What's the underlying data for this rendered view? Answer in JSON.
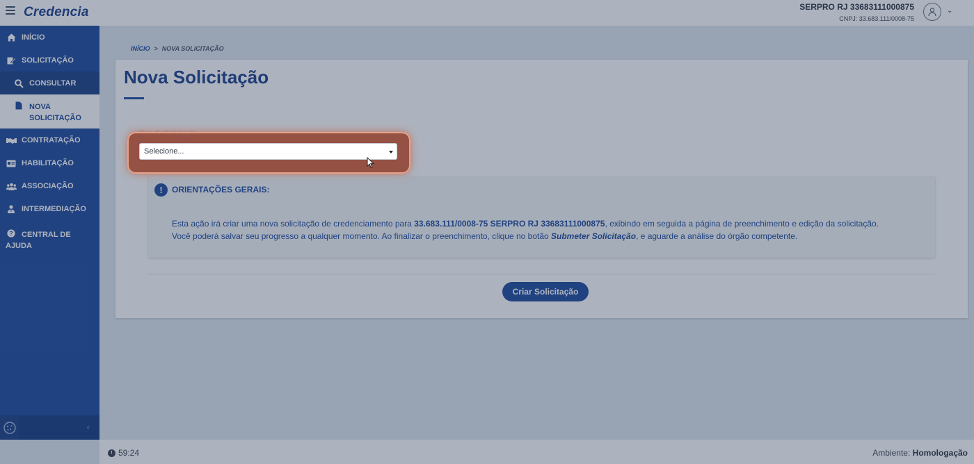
{
  "app": {
    "brand": "Credencia"
  },
  "header": {
    "org_name": "SERPRO RJ 33683111000875",
    "org_cnpj": "CNPJ: 33.683.111/0008-75"
  },
  "sidebar": {
    "items": [
      {
        "label": "Início",
        "icon": "home-icon"
      },
      {
        "label": "Solicitação",
        "icon": "edit-icon"
      },
      {
        "label": "Consultar",
        "icon": "search-icon"
      },
      {
        "label": "Nova Solicitação",
        "icon": "file-icon"
      },
      {
        "label": "Contratação",
        "icon": "handshake-icon"
      },
      {
        "label": "Habilitação",
        "icon": "id-card-icon"
      },
      {
        "label": "Associação",
        "icon": "users-icon"
      },
      {
        "label": "Intermediação",
        "icon": "user-tie-icon"
      },
      {
        "label": "Central de Ajuda",
        "icon": "help-icon"
      }
    ]
  },
  "breadcrumb": {
    "home": "INÍCIO",
    "sep": ">",
    "current": "NOVA SOLICITAÇÃO"
  },
  "main": {
    "title": "Nova Solicitação",
    "field_label": "Tipo de Solicitação",
    "select_value": "Selecione...",
    "orient_title": "ORIENTAÇÕES GERAIS:",
    "line1_pre": "Esta ação irá criar uma nova solicitação de credenciamento para ",
    "line1_bold": "33.683.111/0008-75 SERPRO RJ 33683111000875",
    "line1_post": ", exibindo em seguida a página de preenchimento e edição da solicitação.",
    "line2_pre": "Você poderá salvar seu progresso a qualquer momento. Ao finalizar o preenchimento, clique no botão ",
    "line2_em": "Submeter Solicitação",
    "line2_post": ", e aguarde a análise do órgão competente.",
    "create_button": "Criar Solicitação"
  },
  "footer": {
    "timer": "59:24",
    "env_label": "Ambiente: ",
    "env_value": "Homologação"
  },
  "colors": {
    "primary": "#1d4a9c",
    "highlight": "#d9623a"
  }
}
